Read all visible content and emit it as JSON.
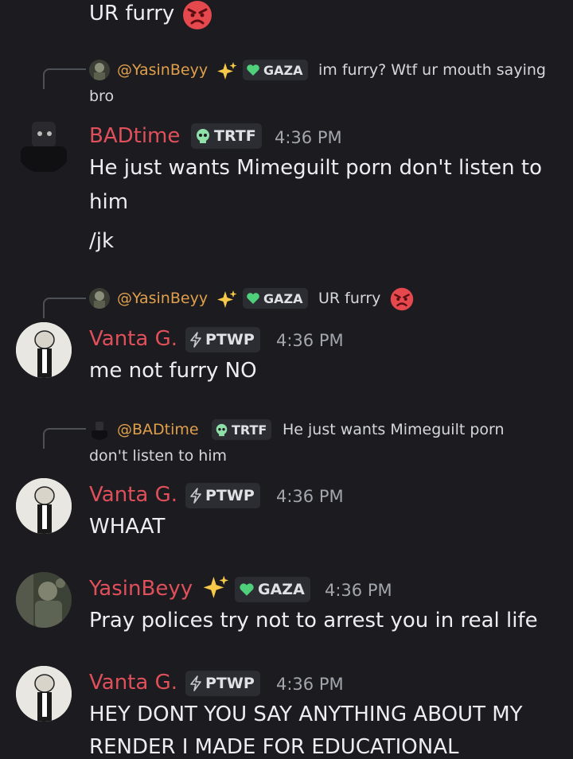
{
  "top_partial": {
    "text": "UR furry",
    "emoji": "angry-face-icon"
  },
  "replies": {
    "r1": {
      "name": "@YasinBeyy",
      "badge": "GAZA",
      "text": "im furry? Wtf ur mouth saying",
      "text_cont": "bro"
    },
    "r2": {
      "name": "@YasinBeyy",
      "badge": "GAZA",
      "text": "UR furry"
    },
    "r3": {
      "name": "@BADtime",
      "badge": "TRTF",
      "text": "He just wants Mimeguilt porn",
      "text_cont": "don't listen to him"
    }
  },
  "messages": {
    "m1": {
      "user": "BADtime",
      "badge": "TRTF",
      "time": "4:36 PM",
      "lines": [
        "He just wants Mimeguilt porn don't listen to",
        "him",
        "/jk"
      ]
    },
    "m2": {
      "user": "Vanta G.",
      "badge": "PTWP",
      "time": "4:36 PM",
      "lines": [
        "me not furry NO"
      ]
    },
    "m3": {
      "user": "Vanta G.",
      "badge": "PTWP",
      "time": "4:36 PM",
      "lines": [
        "WHAAT"
      ]
    },
    "m4": {
      "user": "YasinBeyy",
      "badge": "GAZA",
      "time": "4:36 PM",
      "lines": [
        "Pray polices try not to arrest you in real life"
      ]
    },
    "m5": {
      "user": "Vanta G.",
      "badge": "PTWP",
      "time": "4:36 PM",
      "lines": [
        "HEY DONT YOU SAY ANYTHING ABOUT MY",
        "RENDER I MADE FOR EDUCATIONAL"
      ]
    }
  },
  "colors": {
    "background": "#1b1b20",
    "username_red": "#e0505a",
    "reply_name": "#e0a04b",
    "tag_bg": "#2b2d33"
  }
}
